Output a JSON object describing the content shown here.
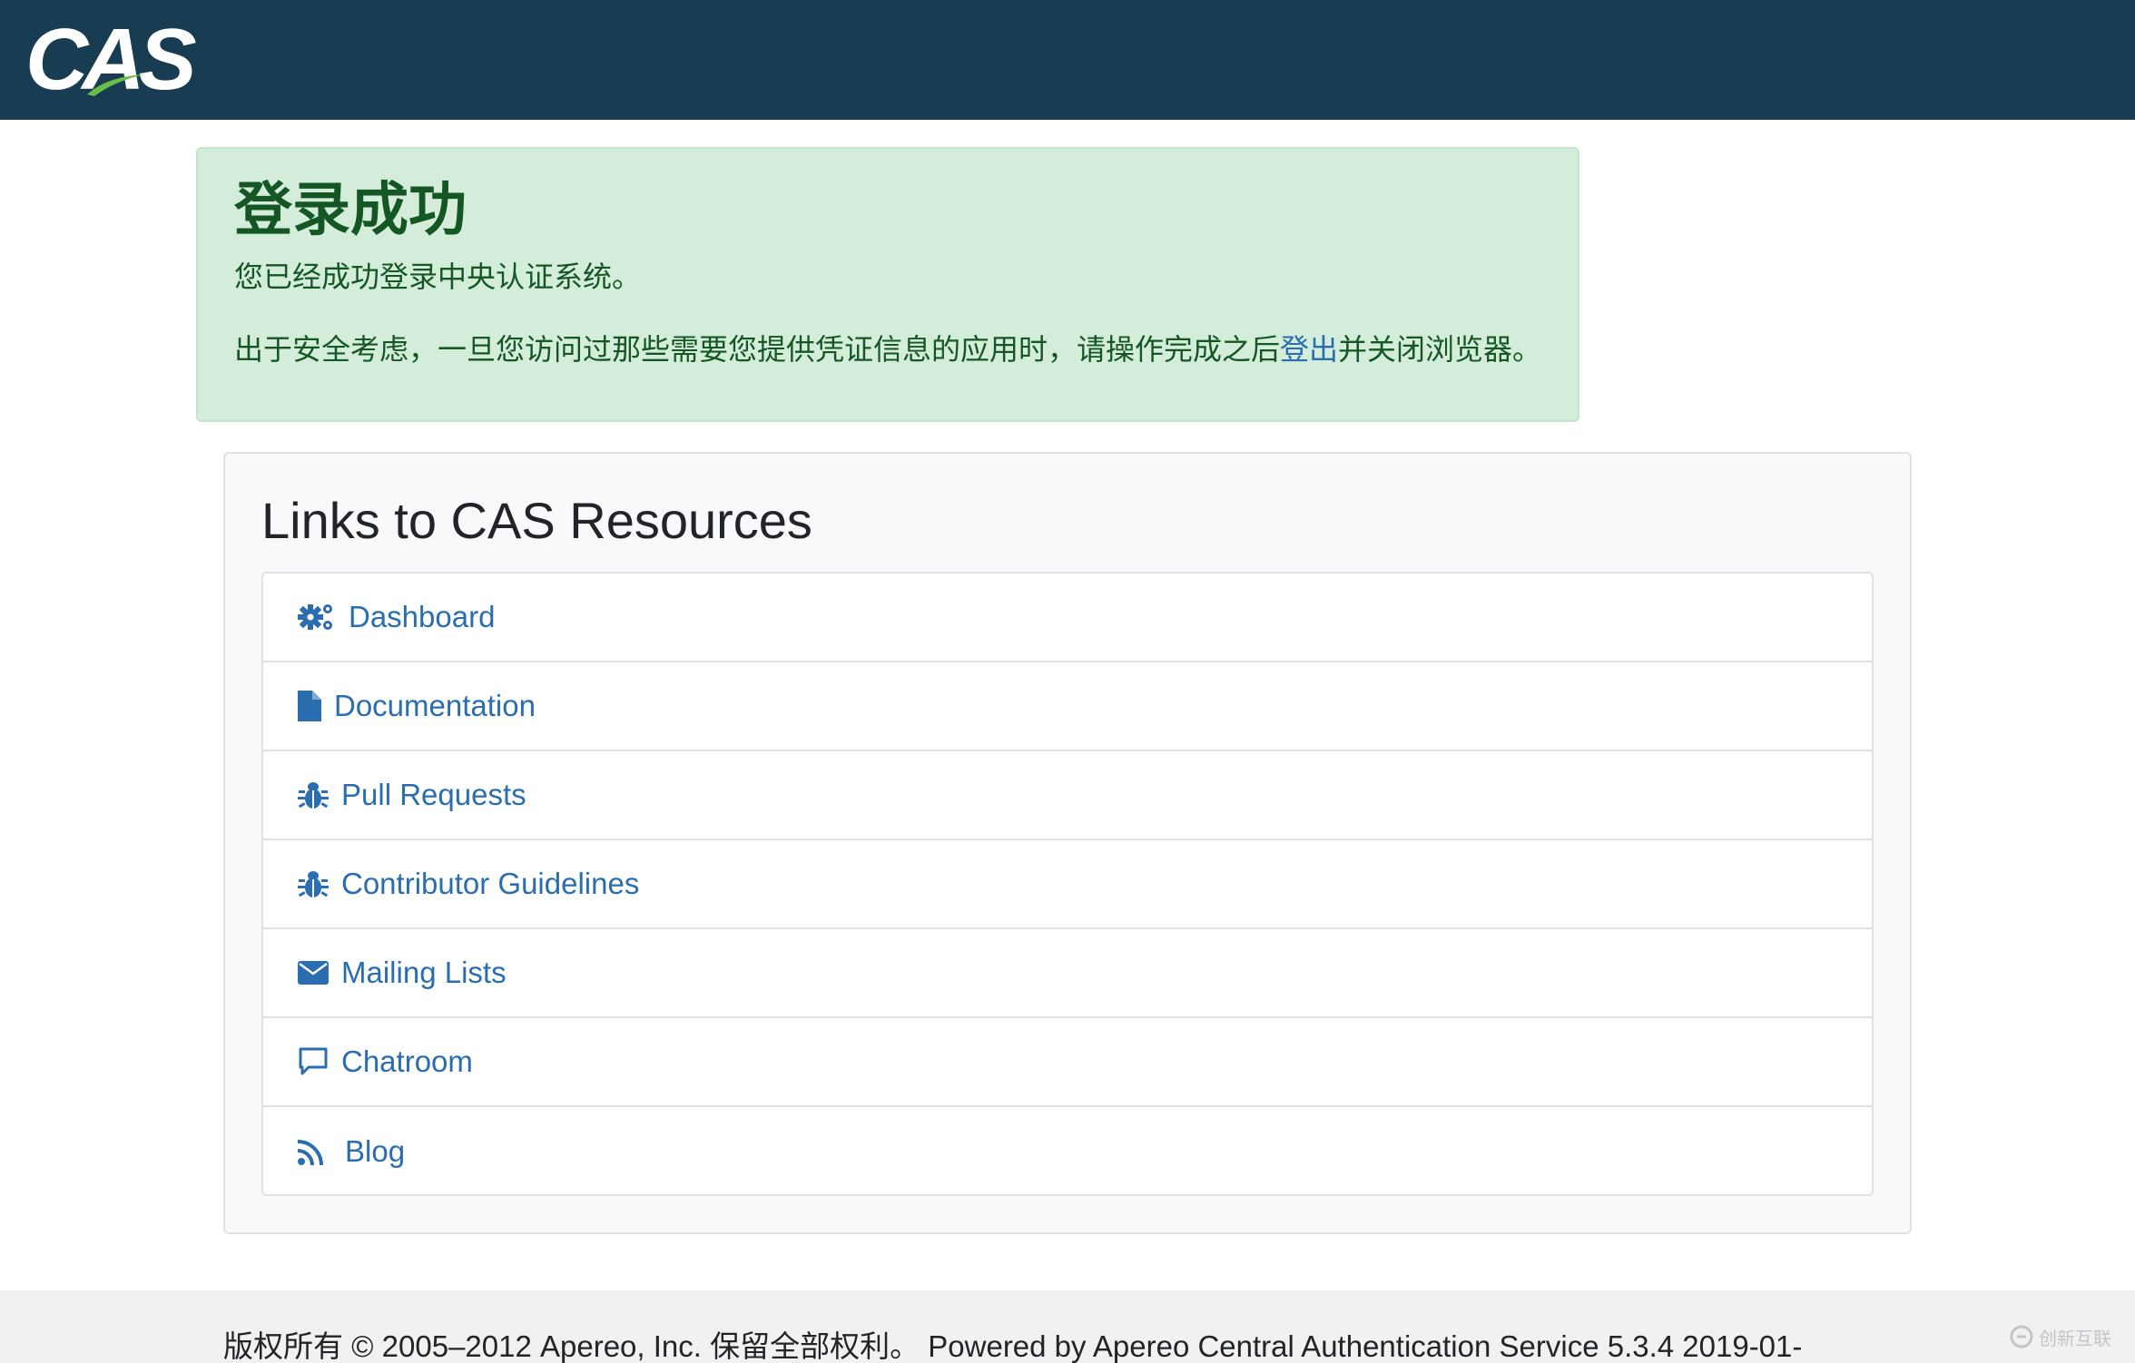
{
  "header": {
    "logo_text": "CAS",
    "background": "#183c51"
  },
  "alert": {
    "title": "登录成功",
    "line1": "您已经成功登录中央认证系统。",
    "line2_before": "出于安全考虑，一旦您访问过那些需要您提供凭证信息的应用时，请操作完成之后",
    "line2_link": "登出",
    "line2_after": "并关闭浏览器。",
    "background": "#d4edda",
    "text_color": "#155724",
    "link_color": "#2a6db0"
  },
  "resources": {
    "title": "Links to CAS Resources",
    "link_color": "#2a6db0",
    "items": [
      {
        "label": "Dashboard",
        "icon": "cogs-icon"
      },
      {
        "label": "Documentation",
        "icon": "file-icon"
      },
      {
        "label": "Pull Requests",
        "icon": "bug-icon"
      },
      {
        "label": "Contributor Guidelines",
        "icon": "bug-icon"
      },
      {
        "label": "Mailing Lists",
        "icon": "envelope-icon"
      },
      {
        "label": "Chatroom",
        "icon": "comment-icon"
      },
      {
        "label": "Blog",
        "icon": "rss-icon"
      }
    ]
  },
  "footer": {
    "text": "版权所有 © 2005–2012 Apereo, Inc. 保留全部权利。 Powered by Apereo Central Authentication Service 5.3.4 2019-01-"
  },
  "watermark": {
    "text": "创新互联"
  }
}
